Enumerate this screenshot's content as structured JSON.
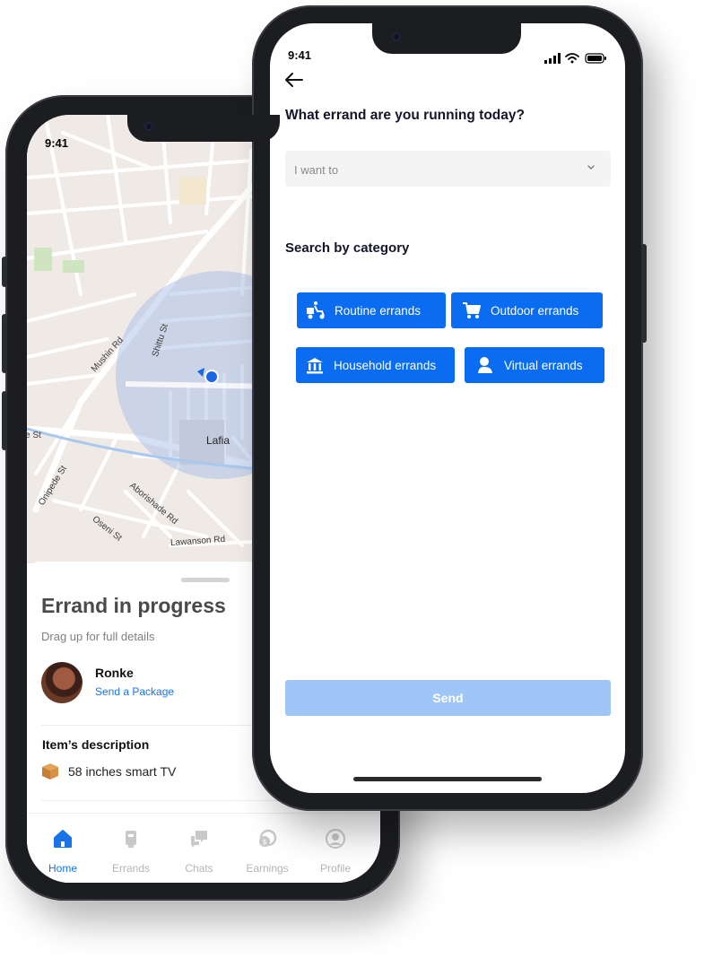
{
  "back_phone": {
    "status_time": "9:41",
    "map": {
      "labels": [
        "Mushin Rd",
        "Shittu St",
        "Lafia",
        "e St",
        "Onipede St",
        "Aborishade Rd",
        "Oseni St",
        "Lawanson Rd"
      ]
    },
    "sheet": {
      "title": "Errand in progress",
      "subtitle": "Drag up for full details",
      "person_name": "Ronke",
      "person_link": "Send a Package",
      "item_heading": "Item’s description",
      "item_text": "58 inches smart TV"
    },
    "tabs": [
      {
        "label": "Home",
        "icon": "home-icon",
        "active": true
      },
      {
        "label": "Errands",
        "icon": "errands-icon",
        "active": false
      },
      {
        "label": "Chats",
        "icon": "chats-icon",
        "active": false
      },
      {
        "label": "Earnings",
        "icon": "earnings-icon",
        "active": false
      },
      {
        "label": "Profile",
        "icon": "profile-icon",
        "active": false
      }
    ]
  },
  "front_phone": {
    "status_time": "9:41",
    "question": "What errand are you running today?",
    "select": {
      "placeholder": "I want to"
    },
    "category_title": "Search by category",
    "categories": [
      {
        "label": "Routine errands",
        "icon": "delivery-scooter-icon"
      },
      {
        "label": "Outdoor errands",
        "icon": "shopping-cart-icon"
      },
      {
        "label": "Household errands",
        "icon": "bank-icon"
      },
      {
        "label": "Virtual errands",
        "icon": "person-icon"
      }
    ],
    "send_label": "Send"
  },
  "colors": {
    "primary": "#0a6cf0",
    "send_disabled": "#9fc6f6",
    "link": "#1a73e8",
    "tab_inactive": "#b5b5b5"
  }
}
